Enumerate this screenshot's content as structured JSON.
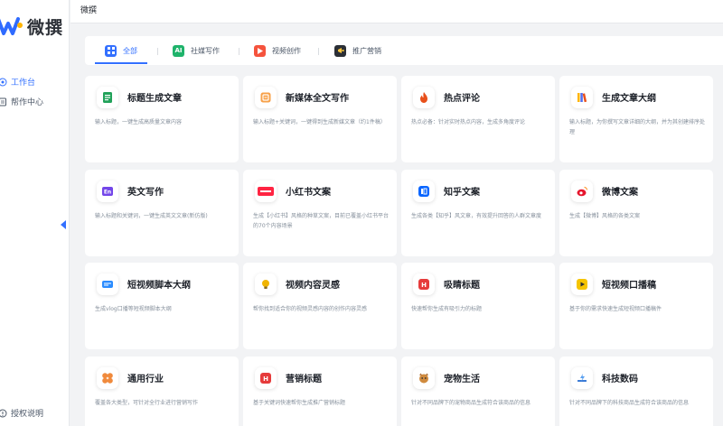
{
  "app": {
    "logo_text": "微撰",
    "page_title": "微撰",
    "brand_color": "#3370ff"
  },
  "sidebar": {
    "items": [
      {
        "label": "工作台",
        "icon": "workbench-icon",
        "active": true
      },
      {
        "label": "帮作中心",
        "icon": "help-center-icon",
        "active": false
      }
    ],
    "bottom_item": {
      "label": "授权说明",
      "icon": "license-icon"
    }
  },
  "tabs": [
    {
      "label": "全部",
      "icon": "grid-icon",
      "active": true
    },
    {
      "label": "社媒写作",
      "icon": "ai-icon",
      "active": false
    },
    {
      "label": "视频创作",
      "icon": "play-icon",
      "active": false
    },
    {
      "label": "推广营销",
      "icon": "megaphone-icon",
      "active": false
    }
  ],
  "cards": [
    {
      "title": "标题生成文章",
      "desc": "输入标题，一键生成高质量文章内容",
      "icon": "document-icon",
      "color": "#22a25a"
    },
    {
      "title": "新媒体全文写作",
      "desc": "输入标题+关键词，一键得到生成新媒文章（约1件稿）",
      "icon": "edit-icon",
      "color": "#f7a14a"
    },
    {
      "title": "热点评论",
      "desc": "热点必备：针对实时热点内容，生成多角度评论",
      "icon": "flame-icon",
      "color": "#e8501b"
    },
    {
      "title": "生成文章大纲",
      "desc": "输入标题，为你撰写文章详细的大纲，并为其创建排序处理",
      "icon": "books-icon",
      "color": "#4e6ef2"
    },
    {
      "title": "英文写作",
      "desc": "输入标题和关键词，一键生成英文文章(新仿版)",
      "icon": "english-icon",
      "color": "#7346e9"
    },
    {
      "title": "小红书文案",
      "desc": "生成【小红书】风格的种草文案，目前已覆盖小红书平台的70个内容场景",
      "icon": "xiaohongshu-icon",
      "color": "#ff2442"
    },
    {
      "title": "知乎文案",
      "desc": "生成各类【知乎】风文章，有效提升回答的人群文章度",
      "icon": "zhihu-icon",
      "color": "#0a66ff"
    },
    {
      "title": "微博文案",
      "desc": "生成【微博】风格的各类文案",
      "icon": "weibo-icon",
      "color": "#e6162d"
    },
    {
      "title": "短视频脚本大纲",
      "desc": "生成vlog口播等短视频脚本大纲",
      "icon": "video-script-icon",
      "color": "#2b8cff"
    },
    {
      "title": "视频内容灵感",
      "desc": "帮你找到适合你的视频灵感内容的创作内容灵感",
      "icon": "lightbulb-icon",
      "color": "#f0b400"
    },
    {
      "title": "吸睛标题",
      "desc": "快速帮你生成有吸引力的标题",
      "icon": "headline-icon",
      "color": "#e63b3b"
    },
    {
      "title": "短视频口播稿",
      "desc": "基于你的需求快速生成短视频口播稿件",
      "icon": "short-video-icon",
      "color": "#f5c400"
    },
    {
      "title": "通用行业",
      "desc": "覆盖各大类型，可针对全行业进行营销写作",
      "icon": "industry-icon",
      "color": "#f08a3c"
    },
    {
      "title": "营销标题",
      "desc": "基于关键词快速帮你生成推广营销标题",
      "icon": "marketing-title-icon",
      "color": "#e63b3b"
    },
    {
      "title": "宠物生活",
      "desc": "针对不同品牌下的宠物商品生成符合该商品的信息",
      "icon": "pet-icon",
      "color": "#d08b3e"
    },
    {
      "title": "科技数码",
      "desc": "针对不同品牌下的科技商品生成符合该商品的信息",
      "icon": "tech-icon",
      "color": "#3b7bd6"
    }
  ]
}
